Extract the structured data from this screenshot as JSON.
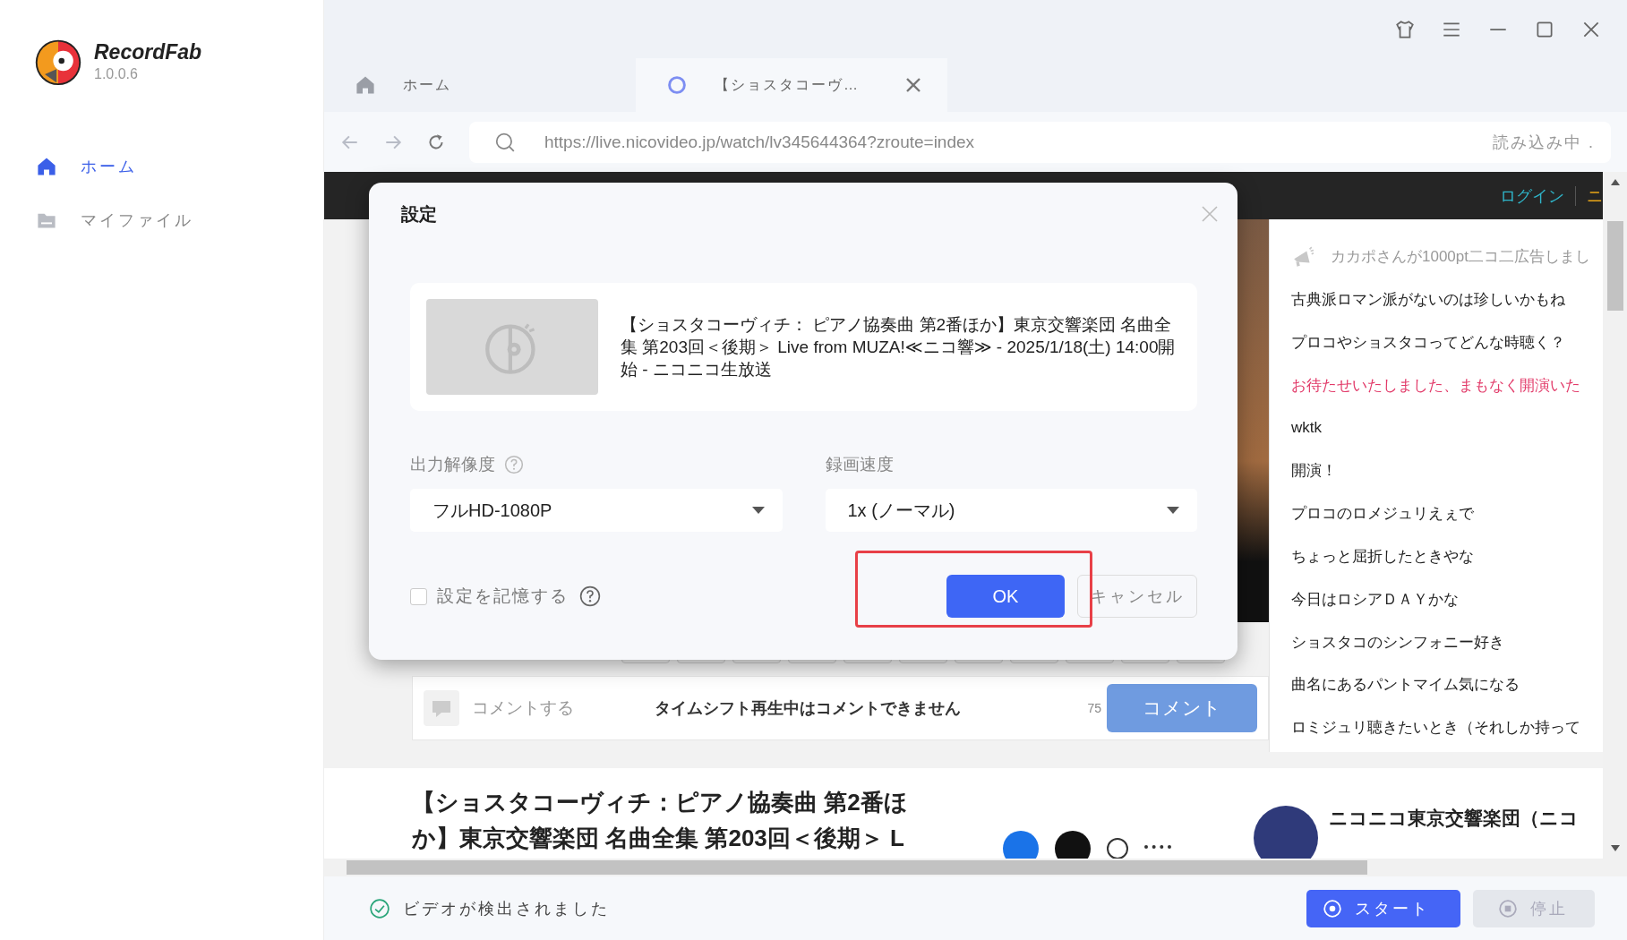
{
  "app": {
    "name": "RecordFab",
    "version": "1.0.0.6"
  },
  "sidebar": {
    "items": [
      {
        "label": "ホーム",
        "kind": "home",
        "selected": true
      },
      {
        "label": "マイファイル",
        "kind": "folder",
        "selected": false
      }
    ]
  },
  "browser_tabs": [
    {
      "label": "ホーム",
      "kind": "home",
      "selected": false
    },
    {
      "label": "【ショスタコーヴ…",
      "kind": "loading",
      "selected": true
    }
  ],
  "address_bar": {
    "url": "https://live.nicovideo.jp/watch/lv345644364?zroute=index",
    "status": "読み込み中 ."
  },
  "page": {
    "header_links": [
      {
        "label": "ログイン",
        "color": "#2fb5c9"
      },
      {
        "label": "ニ",
        "color": "#e6a417"
      }
    ],
    "chat": [
      {
        "text": "カカポさんが1000pt二コ二広告しまし",
        "kind": "ad"
      },
      {
        "text": "古典派ロマン派がないのは珍しいかもね",
        "kind": "normal"
      },
      {
        "text": "プロコやショスタコってどんな時聴く？",
        "kind": "normal"
      },
      {
        "text": "お待たせいたしました、まもなく開演いた",
        "kind": "system"
      },
      {
        "text": "wktk",
        "kind": "normal"
      },
      {
        "text": "開演！",
        "kind": "normal"
      },
      {
        "text": "プロコのロメジュリえぇで",
        "kind": "normal"
      },
      {
        "text": "ちょっと屈折したときやな",
        "kind": "normal"
      },
      {
        "text": "今日はロシアＤＡＹかな",
        "kind": "normal"
      },
      {
        "text": "ショスタコのシンフォニー好き",
        "kind": "normal"
      },
      {
        "text": "曲名にあるパントマイム気になる",
        "kind": "normal"
      },
      {
        "text": "ロミジュリ聴きたいとき（それしか持って",
        "kind": "normal"
      }
    ],
    "comment_bar": {
      "placeholder": "コメントする",
      "notice": "タイムシフト再生中はコメントできません",
      "count": "75",
      "button": "コメント"
    },
    "title_lines": [
      "【ショスタコーヴィチ：ピアノ協奏曲 第2番ほ",
      "か】東京交響楽団 名曲全集 第203回＜後期＞ L"
    ],
    "channel_name": "ニコニコ東京交響楽団（ニコ"
  },
  "dialog": {
    "title": "設定",
    "video_title": "【ショスタコーヴィチ： ピアノ協奏曲 第2番ほか】東京交響楽団 名曲全集 第203回＜後期＞ Live from MUZA!≪ニコ響≫ - 2025/1/18(土) 14:00開始 - ニコニコ生放送",
    "resolution": {
      "label": "出力解像度",
      "value": "フルHD-1080P"
    },
    "speed": {
      "label": "録画速度",
      "value": "1x (ノーマル)"
    },
    "remember": {
      "label": "設定を記憶する",
      "checked": false
    },
    "ok": "OK",
    "cancel": "キャンセル",
    "ok_highlighted": true
  },
  "status_bar": {
    "message": "ビデオが検出されました",
    "start": "スタート",
    "stop": "停止",
    "stop_disabled": true
  }
}
